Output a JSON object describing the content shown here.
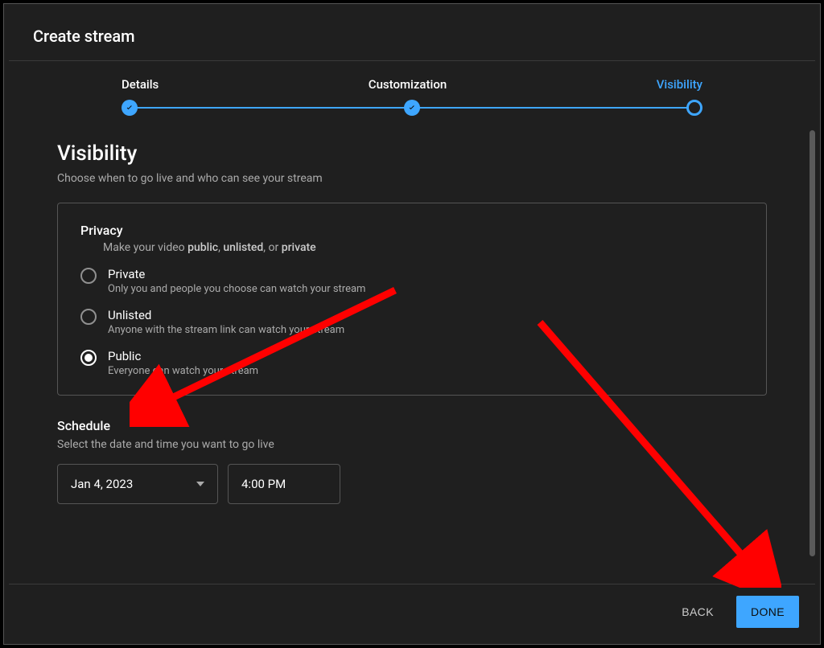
{
  "header": {
    "title": "Create stream"
  },
  "stepper": {
    "steps": [
      {
        "label": "Details",
        "state": "done"
      },
      {
        "label": "Customization",
        "state": "done"
      },
      {
        "label": "Visibility",
        "state": "active"
      }
    ]
  },
  "visibility": {
    "heading": "Visibility",
    "subtitle": "Choose when to go live and who can see your stream",
    "privacy": {
      "title": "Privacy",
      "subtitle_prefix": "Make your video ",
      "subtitle_options": [
        "public",
        "unlisted",
        "private"
      ],
      "subtitle_joiner": ", ",
      "subtitle_last_joiner": ", or ",
      "options": [
        {
          "id": "private",
          "label": "Private",
          "desc": "Only you and people you choose can watch your stream",
          "selected": false
        },
        {
          "id": "unlisted",
          "label": "Unlisted",
          "desc": "Anyone with the stream link can watch your stream",
          "selected": false
        },
        {
          "id": "public",
          "label": "Public",
          "desc": "Everyone can watch your stream",
          "selected": true
        }
      ]
    },
    "schedule": {
      "title": "Schedule",
      "subtitle": "Select the date and time you want to go live",
      "date": "Jan 4, 2023",
      "time": "4:00 PM"
    }
  },
  "footer": {
    "back": "BACK",
    "done": "DONE"
  },
  "annotations": {
    "arrow_to_public": true,
    "arrow_to_done": true
  }
}
